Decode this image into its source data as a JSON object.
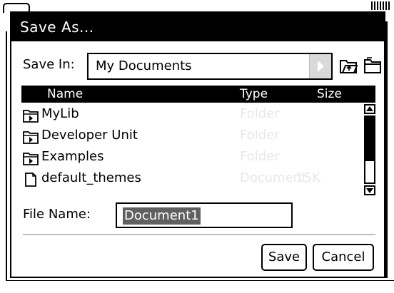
{
  "dialog": {
    "title": "Save As..."
  },
  "save_in": {
    "label": "Save In:",
    "value": "My Documents"
  },
  "file_list": {
    "columns": {
      "name": "Name",
      "type": "Type",
      "size": "Size"
    },
    "rows": [
      {
        "icon": "folder-icon",
        "name": "MyLib",
        "type": "Folder",
        "size": ""
      },
      {
        "icon": "folder-icon",
        "name": "Developer Unit",
        "type": "Folder",
        "size": ""
      },
      {
        "icon": "folder-icon",
        "name": "Examples",
        "type": "Folder",
        "size": ""
      },
      {
        "icon": "document-icon",
        "name": "default_themes",
        "type": "Document",
        "size": "15K"
      }
    ]
  },
  "file_name": {
    "label": "File Name:",
    "value": "Document1"
  },
  "buttons": {
    "save": "Save",
    "cancel": "Cancel"
  }
}
